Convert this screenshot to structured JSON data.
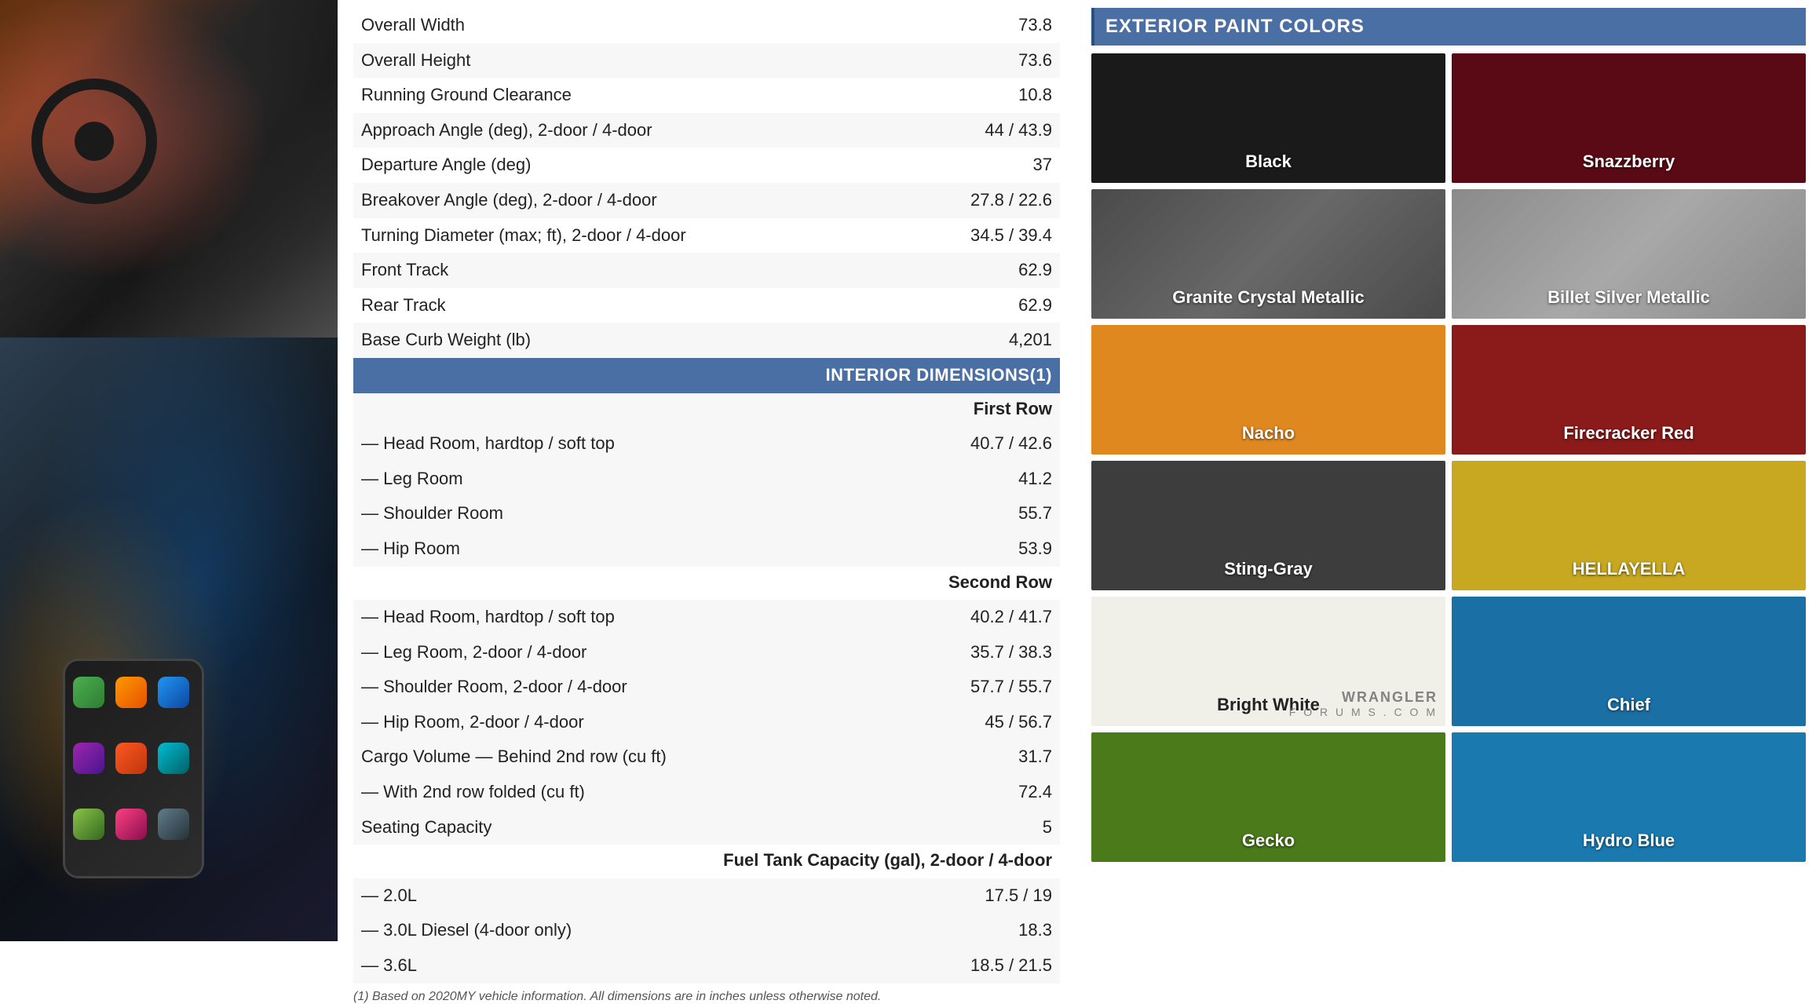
{
  "images": {
    "top_alt": "Jeep Wrangler interior with steering wheel and red dashboard",
    "bottom_alt": "Hand holding phone showing CarPlay interface near Jeep infotainment"
  },
  "specs": {
    "section1_rows": [
      {
        "label": "Overall Width",
        "value": "73.8"
      },
      {
        "label": "Overall Height",
        "value": "73.6"
      },
      {
        "label": "Running Ground Clearance",
        "value": "10.8"
      },
      {
        "label": "Approach Angle (deg), 2-door / 4-door",
        "value": "44 / 43.9"
      },
      {
        "label": "Departure Angle (deg)",
        "value": "37"
      },
      {
        "label": "Breakover Angle (deg), 2-door / 4-door",
        "value": "27.8 / 22.6"
      },
      {
        "label": "Turning Diameter (max; ft), 2-door / 4-door",
        "value": "34.5 / 39.4"
      },
      {
        "label": "Front Track",
        "value": "62.9"
      },
      {
        "label": "Rear Track",
        "value": "62.9"
      },
      {
        "label": "Base Curb Weight (lb)",
        "value": "4,201"
      }
    ],
    "section2_header": "INTERIOR DIMENSIONS(1)",
    "section2_rows": [
      {
        "label": "First Row",
        "value": "",
        "subheader": true
      },
      {
        "label": "— Head Room, hardtop / soft top",
        "value": "40.7 / 42.6"
      },
      {
        "label": "— Leg Room",
        "value": "41.2"
      },
      {
        "label": "— Shoulder Room",
        "value": "55.7"
      },
      {
        "label": "— Hip Room",
        "value": "53.9"
      },
      {
        "label": "Second Row",
        "value": "",
        "subheader": true
      },
      {
        "label": "— Head Room, hardtop / soft top",
        "value": "40.2 / 41.7"
      },
      {
        "label": "— Leg Room, 2-door / 4-door",
        "value": "35.7 / 38.3"
      },
      {
        "label": "— Shoulder Room, 2-door / 4-door",
        "value": "57.7 / 55.7"
      },
      {
        "label": "— Hip Room, 2-door / 4-door",
        "value": "45 / 56.7"
      },
      {
        "label": "Cargo Volume — Behind 2nd row (cu ft)",
        "value": "31.7"
      },
      {
        "label": "— With 2nd row folded (cu ft)",
        "value": "72.4"
      },
      {
        "label": "Seating Capacity",
        "value": "5"
      },
      {
        "label": "Fuel Tank Capacity (gal), 2-door / 4-door",
        "value": "",
        "subheader": true
      },
      {
        "label": "— 2.0L",
        "value": "17.5 / 19"
      },
      {
        "label": "— 3.0L Diesel (4-door only)",
        "value": "18.3"
      },
      {
        "label": "— 3.6L",
        "value": "18.5 / 21.5"
      }
    ],
    "footnote": "(1) Based on 2020MY vehicle information. All dimensions are in inches unless otherwise noted."
  },
  "paint_section": {
    "header": "EXTERIOR PAINT COLORS",
    "colors": [
      {
        "name": "Black",
        "hex": "#1a1a1a",
        "text_class": "light"
      },
      {
        "name": "Snazzberry",
        "hex": "#5a0a15",
        "text_class": "light"
      },
      {
        "name": "Granite Crystal Metallic",
        "hex": "#4a4a4a",
        "text_class": "light"
      },
      {
        "name": "Billet Silver Metallic",
        "hex": "#8a8a8a",
        "text_class": "light"
      },
      {
        "name": "Nacho",
        "hex": "#e08820",
        "text_class": "light"
      },
      {
        "name": "Firecracker Red",
        "hex": "#8b1a1a",
        "text_class": "light"
      },
      {
        "name": "Sting-Gray",
        "hex": "#3d3d3d",
        "text_class": "light"
      },
      {
        "name": "HELLAYELLA",
        "hex": "#c8a820",
        "text_class": "light"
      },
      {
        "name": "Bright White",
        "hex": "#f0f0e8",
        "text_class": "dark"
      },
      {
        "name": "Chief",
        "hex": "#1a6fa5",
        "text_class": "light"
      },
      {
        "name": "Gecko",
        "hex": "#4a7a1a",
        "text_class": "light"
      },
      {
        "name": "Hydro Blue",
        "hex": "#1a7ab0",
        "text_class": "light"
      }
    ],
    "watermark_line1": "WRANGLER",
    "watermark_line2": "F O R U M S . C O M"
  }
}
